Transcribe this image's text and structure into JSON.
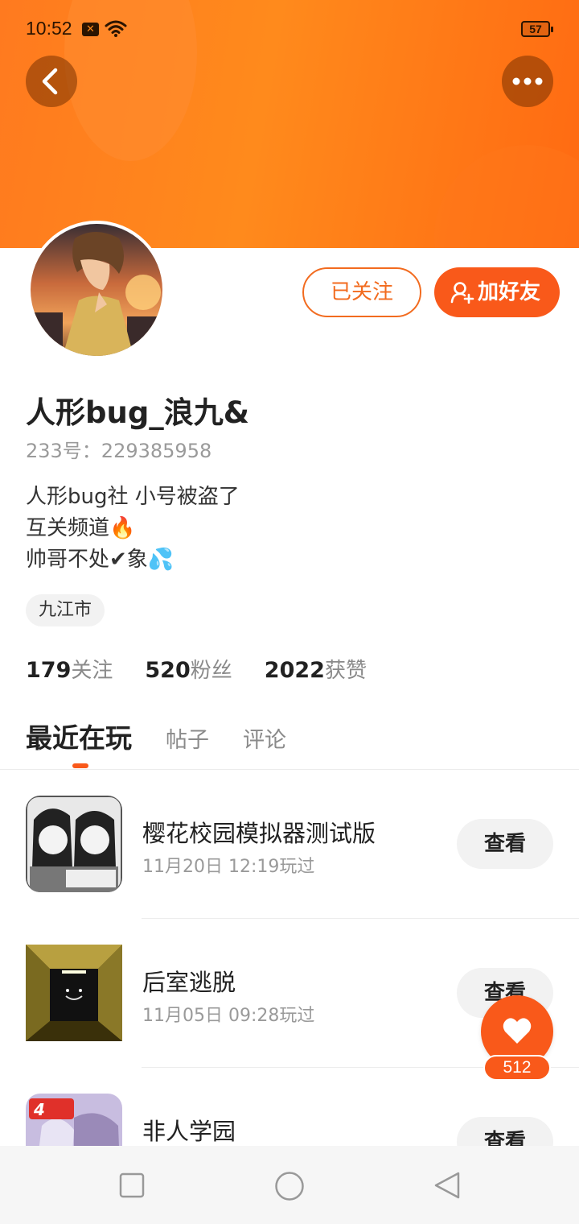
{
  "status_bar": {
    "time": "10:52",
    "sim_icon": "sim-x-icon",
    "wifi_icon": "wifi-icon",
    "battery_level": "57"
  },
  "header": {
    "back_icon": "back-arrow-icon",
    "more_icon": "more-dots-icon"
  },
  "profile": {
    "username": "人形bug_浪九&",
    "account_id": "233号：229385958",
    "bio_lines": [
      "人形bug社  小号被盗了",
      "互关频道🔥",
      "帅哥不处✔象💦"
    ],
    "location": "九江市",
    "follow_button": "已关注",
    "add_friend_button": "加好友"
  },
  "stats": [
    {
      "value": "179",
      "label": "关注"
    },
    {
      "value": "520",
      "label": "粉丝"
    },
    {
      "value": "2022",
      "label": "获赞"
    }
  ],
  "tabs": [
    {
      "label": "最近在玩",
      "active": true
    },
    {
      "label": "帖子",
      "active": false
    },
    {
      "label": "评论",
      "active": false
    }
  ],
  "games": [
    {
      "title": "樱花校园模拟器测试版",
      "played": "11月20日 12:19玩过",
      "button": "查看"
    },
    {
      "title": "后室逃脱",
      "played": "11月05日 09:28玩过",
      "button": "查看"
    },
    {
      "title": "非人学园",
      "played": "",
      "button": "查看"
    }
  ],
  "like_fab": {
    "icon": "heart-icon",
    "count": "512"
  },
  "colors": {
    "accent": "#f9591a",
    "banner": "#ff8a1c"
  }
}
